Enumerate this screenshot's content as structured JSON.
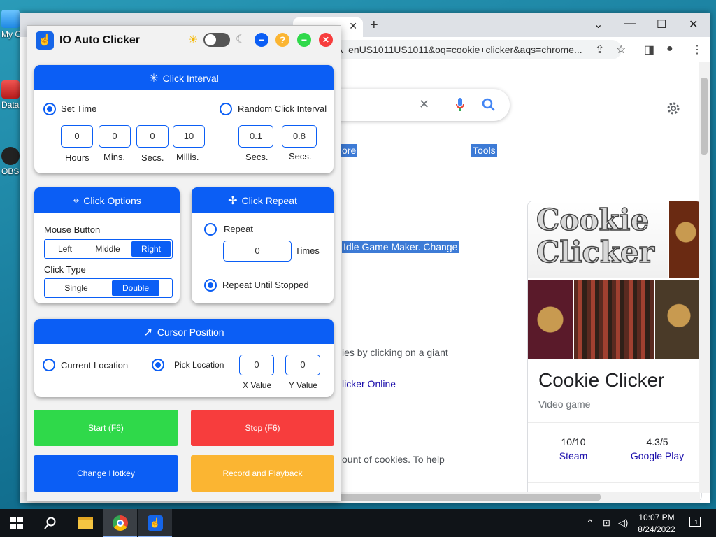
{
  "desktop": {
    "icons": [
      {
        "label": "My C",
        "icon": "computer-icon"
      },
      {
        "label": "Data",
        "icon": "database-icon"
      },
      {
        "label": "OBS",
        "icon": "obs-icon"
      }
    ]
  },
  "browser": {
    "address": "A_enUS1011US1011&oq=cookie+clicker&aqs=chrome...",
    "tab_close": "✕",
    "new_tab": "+",
    "window_controls": {
      "dropdown": "⌄",
      "minimize": "—",
      "maximize": "☐",
      "close": "✕"
    },
    "toolbar_icons": [
      "share-icon",
      "bookmark-star-icon",
      "sidepanel-icon",
      "profile-icon",
      "menu-icon"
    ],
    "search": {
      "clear_icon": "✕",
      "mic_icon": "mic-icon",
      "search_icon": "search-icon"
    },
    "settings_icon": "gear-icon",
    "highlighted": {
      "more": "ore",
      "tools": "Tools",
      "snippet1": "Idle Game Maker. Change"
    },
    "snippets": {
      "s2": "ies by clicking on a giant",
      "s3": "licker Online",
      "s4": "ount of cookies. To help",
      "s5": "…"
    },
    "knowledge_panel": {
      "logo_line1": "Cookie",
      "logo_line2": "Clicker",
      "title": "Cookie Clicker",
      "subtitle": "Video game",
      "ratings": [
        {
          "value": "10/10",
          "source": "Steam"
        },
        {
          "value": "4.3/5",
          "source": "Google Play"
        }
      ]
    }
  },
  "app": {
    "title": "IO Auto Clicker",
    "theme": {
      "light_icon": "☀",
      "dark_icon": "☾"
    },
    "buttons": {
      "minimize": "−",
      "help": "?",
      "maximize": "−",
      "close": "✕"
    },
    "click_interval": {
      "header": "Click Interval",
      "set_time_label": "Set Time",
      "random_label": "Random Click Interval",
      "fields": [
        {
          "value": "0",
          "label": "Hours"
        },
        {
          "value": "0",
          "label": "Mins."
        },
        {
          "value": "0",
          "label": "Secs."
        },
        {
          "value": "10",
          "label": "Millis."
        }
      ],
      "random_fields": [
        {
          "value": "0.1",
          "label": "Secs."
        },
        {
          "value": "0.8",
          "label": "Secs."
        }
      ]
    },
    "click_options": {
      "header": "Click Options",
      "mouse_button_label": "Mouse Button",
      "mouse_buttons": [
        "Left",
        "Middle",
        "Right"
      ],
      "mouse_selected": "Right",
      "click_type_label": "Click Type",
      "click_types": [
        "Single",
        "Double"
      ],
      "click_type_selected": "Double"
    },
    "click_repeat": {
      "header": "Click Repeat",
      "repeat_label": "Repeat",
      "repeat_value": "0",
      "times_label": "Times",
      "until_stopped_label": "Repeat Until Stopped"
    },
    "cursor_position": {
      "header": "Cursor Position",
      "current_label": "Current Location",
      "pick_label": "Pick Location",
      "x_value": "0",
      "y_value": "0",
      "x_label": "X Value",
      "y_label": "Y Value"
    },
    "actions": {
      "start": "Start (F6)",
      "stop": "Stop (F6)",
      "change_hotkey": "Change Hotkey",
      "record": "Record and Playback"
    },
    "colors": {
      "blue": "#0b5ef5",
      "green": "#2fd94a",
      "red": "#f73d3d",
      "orange": "#fbb532"
    }
  },
  "taskbar": {
    "time": "10:07 PM",
    "date": "8/24/2022",
    "notification_count": "1"
  }
}
